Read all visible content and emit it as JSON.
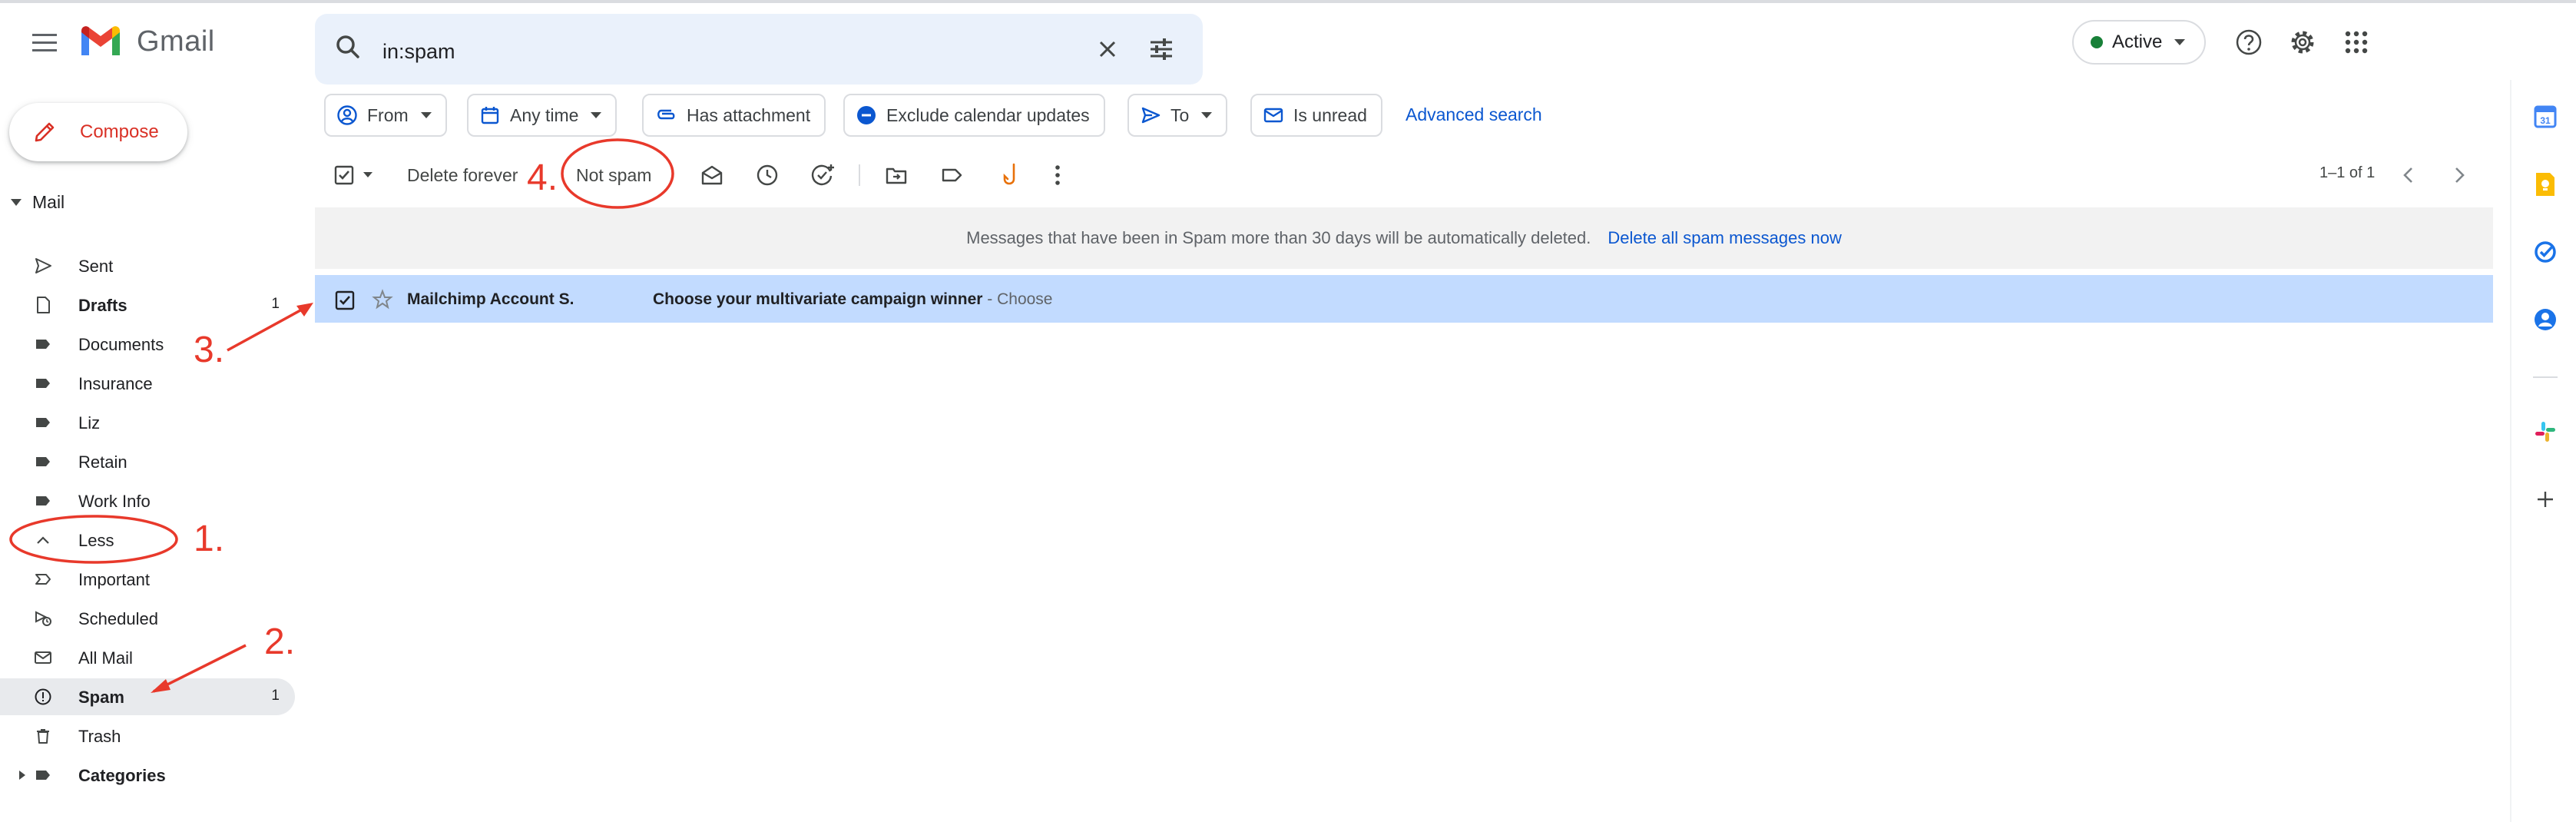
{
  "header": {
    "app_name": "Gmail",
    "search_value": "in:spam",
    "status_label": "Active"
  },
  "compose_label": "Compose",
  "mail_section_label": "Mail",
  "sidebar": {
    "items": [
      {
        "label": "Sent",
        "count": "",
        "icon": "send-icon"
      },
      {
        "label": "Drafts",
        "count": "1",
        "icon": "draft-icon",
        "bold": true
      },
      {
        "label": "Documents",
        "count": "",
        "icon": "label-icon"
      },
      {
        "label": "Insurance",
        "count": "",
        "icon": "label-icon"
      },
      {
        "label": "Liz",
        "count": "",
        "icon": "label-icon"
      },
      {
        "label": "Retain",
        "count": "",
        "icon": "label-icon"
      },
      {
        "label": "Work Info",
        "count": "",
        "icon": "label-icon"
      },
      {
        "label": "Less",
        "count": "",
        "icon": "chevron-up-icon"
      },
      {
        "label": "Important",
        "count": "",
        "icon": "important-icon"
      },
      {
        "label": "Scheduled",
        "count": "",
        "icon": "scheduled-icon"
      },
      {
        "label": "All Mail",
        "count": "",
        "icon": "mail-icon"
      },
      {
        "label": "Spam",
        "count": "1",
        "icon": "spam-icon",
        "bold": true,
        "active": true
      },
      {
        "label": "Trash",
        "count": "",
        "icon": "trash-icon"
      },
      {
        "label": "Categories",
        "count": "",
        "icon": "label-icon",
        "bold": true
      }
    ]
  },
  "filters": {
    "from": "From",
    "any_time": "Any time",
    "has_attachment": "Has attachment",
    "exclude_calendar": "Exclude calendar updates",
    "to": "To",
    "is_unread": "Is unread",
    "advanced_search": "Advanced search"
  },
  "toolbar": {
    "delete_forever": "Delete forever",
    "not_spam": "Not spam",
    "pager": "1–1 of 1"
  },
  "banner": {
    "message": "Messages that have been in Spam more than 30 days will be automatically deleted.",
    "link": "Delete all spam messages now"
  },
  "messages": [
    {
      "sender": "Mailchimp Account S.",
      "subject": "Choose your multivariate campaign winner",
      "snippet": " - Choose",
      "selected": true
    }
  ],
  "annotations": {
    "step1": "1.",
    "step2": "2.",
    "step3": "3.",
    "step4": "4."
  },
  "colors": {
    "accent": "#0b57d0",
    "compose_red": "#d93025",
    "annotation_red": "#e8392b",
    "selected_row": "#c2dbff",
    "status_green": "#188038"
  }
}
